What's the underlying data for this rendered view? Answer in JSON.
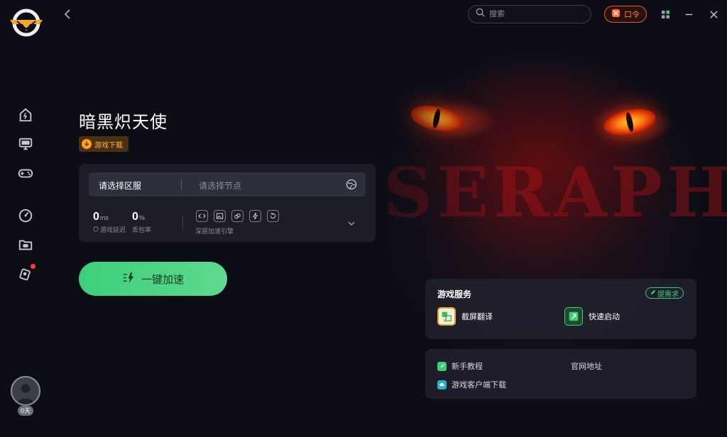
{
  "topbar": {
    "search_placeholder": "搜索",
    "kouling_label": "口令"
  },
  "game": {
    "title": "暗黑炽天使",
    "download_label": "游戏下载"
  },
  "panel": {
    "region_label": "请选择区服",
    "node_placeholder": "请选择节点",
    "latency_value": "0",
    "latency_unit": "ms",
    "latency_label": "游戏延迟",
    "loss_value": "0",
    "loss_unit": "%",
    "loss_label": "丢包率",
    "engine_label": "深层加速引擎"
  },
  "accelerate": {
    "label": "一键加速"
  },
  "services": {
    "title": "游戏服务",
    "request_label": "提需求",
    "items": [
      {
        "label": "截屏翻译",
        "icon": "translate-icon"
      },
      {
        "label": "快速启动",
        "icon": "quick-launch-icon"
      }
    ]
  },
  "links": {
    "tutorial": "新手教程",
    "website": "官网地址",
    "client_download": "游戏客户端下载"
  },
  "user": {
    "days": "0天"
  },
  "background": {
    "text": "SERAPH"
  },
  "colors": {
    "accent_green": "#3ccf7a",
    "orange": "#ff7a45",
    "background": "#0d0d16"
  }
}
